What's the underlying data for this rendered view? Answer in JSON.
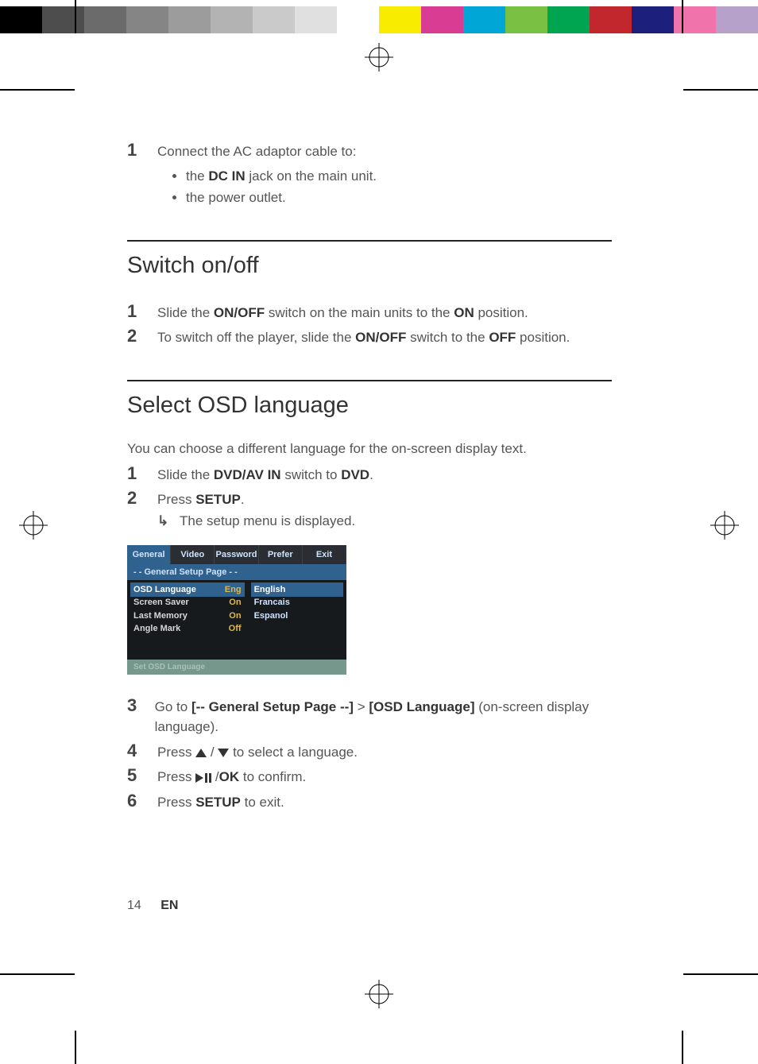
{
  "colorbar": [
    "#000000",
    "#4d4d4d",
    "#6b6b6b",
    "#858585",
    "#9c9c9c",
    "#b3b3b3",
    "#cacaca",
    "#e0e0e0",
    "#ffffff",
    "#f8ec00",
    "#d93d93",
    "#00a6d6",
    "#7ac143",
    "#00a551",
    "#c2272d",
    "#1c1f7c",
    "#f173ac",
    "#b5a1c9"
  ],
  "section0": {
    "step1_num": "1",
    "step1_text": "Connect the AC adaptor cable to:",
    "bullet1_pre": "the ",
    "bullet1_bold": "DC IN",
    "bullet1_post": " jack on the main unit.",
    "bullet2": "the power outlet."
  },
  "section1": {
    "heading": "Switch on/off",
    "step1_num": "1",
    "step1_pre": "Slide the ",
    "step1_b1": "ON/OFF",
    "step1_mid": " switch on the main units to the ",
    "step1_b2": "ON",
    "step1_post": " position.",
    "step2_num": "2",
    "step2_pre": "To switch off the player, slide the ",
    "step2_b1": "ON/OFF",
    "step2_mid": " switch to the ",
    "step2_b2": "OFF",
    "step2_post": " position."
  },
  "section2": {
    "heading": "Select OSD language",
    "intro": "You can choose a different language for the on-screen display text.",
    "step1_num": "1",
    "step1_pre": "Slide the ",
    "step1_b1": "DVD/AV IN",
    "step1_mid": " switch to ",
    "step1_b2": "DVD",
    "step1_post": ".",
    "step2_num": "2",
    "step2_pre": "Press ",
    "step2_b1": "SETUP",
    "step2_post": ".",
    "step2_sub": "The setup menu is displayed.",
    "arrow_glyph": "↳",
    "step3_num": "3",
    "step3_pre": "Go to ",
    "step3_b1": "[-- General Setup Page --]",
    "step3_gt": " > ",
    "step3_b2": "[OSD Language]",
    "step3_post": " (on-screen display language).",
    "step4_num": "4",
    "step4_pre": "Press ",
    "step4_mid": " / ",
    "step4_post": " to select a language.",
    "step5_num": "5",
    "step5_pre": "Press ",
    "step5_mid": " /",
    "step5_b1": "OK",
    "step5_post": " to confirm.",
    "step6_num": "6",
    "step6_pre": "Press ",
    "step6_b1": "SETUP",
    "step6_post": " to exit."
  },
  "osd": {
    "tabs": [
      "General",
      "Video",
      "Password",
      "Prefer",
      "Exit"
    ],
    "header": "- -   General Setup Page   - -",
    "rows": [
      {
        "label": "OSD  Language",
        "val": "Eng",
        "selected": true
      },
      {
        "label": "Screen Saver",
        "val": "On"
      },
      {
        "label": "Last Memory",
        "val": "On"
      },
      {
        "label": "Angle Mark",
        "val": "Off"
      }
    ],
    "options": [
      {
        "label": "English",
        "selected": true
      },
      {
        "label": "Francais"
      },
      {
        "label": "Espanol"
      }
    ],
    "footer": "Set OSD Language"
  },
  "footer": {
    "page": "14",
    "lang": "EN"
  }
}
